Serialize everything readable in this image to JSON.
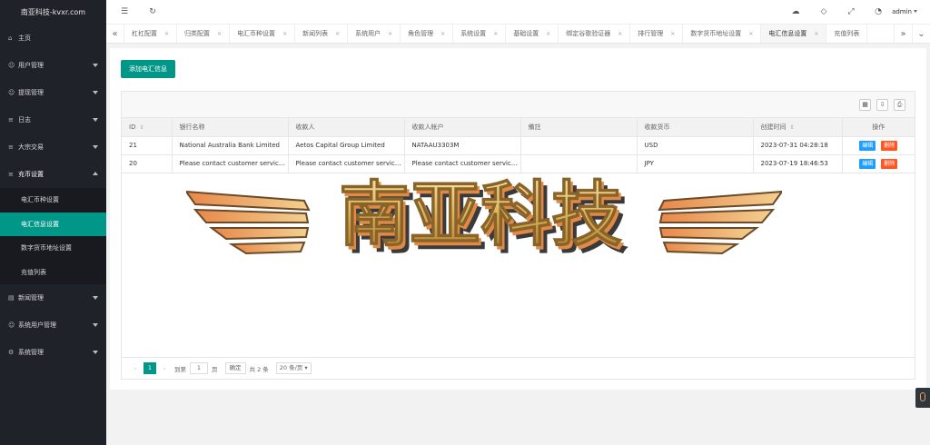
{
  "app": {
    "title": "南亚科技-kvxr.com"
  },
  "sidebar": {
    "items": [
      {
        "label": "主页",
        "icon": "home-icon"
      },
      {
        "label": "用户管理",
        "icon": "user-icon"
      },
      {
        "label": "提现管理",
        "icon": "user-icon"
      },
      {
        "label": "日志",
        "icon": "log-icon"
      },
      {
        "label": "大宗交易",
        "icon": "list-icon"
      },
      {
        "label": "充币设置",
        "icon": "list-icon"
      }
    ],
    "sub_items": [
      "电汇币种设置",
      "电汇信息设置",
      "数字货币地址设置",
      "充值列表"
    ],
    "items_after": [
      {
        "label": "新闻管理",
        "icon": "news-icon"
      },
      {
        "label": "系统用户管理",
        "icon": "user-icon"
      },
      {
        "label": "系统管理",
        "icon": "gear-icon"
      }
    ]
  },
  "header": {
    "user": "admin"
  },
  "tabs": [
    "杠杠配置",
    "归类配置",
    "电汇币种设置",
    "新闻列表",
    "系统用户",
    "角色管理",
    "系统设置",
    "基础设置",
    "绑定谷歌验证器",
    "排行管理",
    "数字货币地址设置",
    "电汇信息设置",
    "充值列表"
  ],
  "main": {
    "add_button": "添加电汇信息",
    "columns": [
      "ID",
      "银行名称",
      "收款人",
      "收款人帐户",
      "備註",
      "收款货币",
      "创建时间",
      "操作"
    ],
    "rows": [
      [
        "21",
        "National Australia Bank Limited",
        "Aetos Capital Group Limited",
        "NATAAU3303M",
        "",
        "USD",
        "2023-07-31 04:28:18"
      ],
      [
        "20",
        "Please contact customer servic...",
        "Please contact customer servic...",
        "Please contact customer servic...",
        "",
        "JPY",
        "2023-07-19 18:46:53"
      ]
    ],
    "edit_label": "编辑",
    "delete_label": "删除"
  },
  "pager": {
    "current_page": "1",
    "goto_label": "到第",
    "page_input": "1",
    "page_unit": "页",
    "confirm": "确定",
    "total": "共 2 条",
    "page_size": "20 条/页"
  },
  "watermark": {
    "text": "南亚科技"
  },
  "colors": {
    "accent": "#009688",
    "sidebar_bg": "#20222a",
    "edit": "#1e9fff",
    "delete": "#ff5722"
  }
}
